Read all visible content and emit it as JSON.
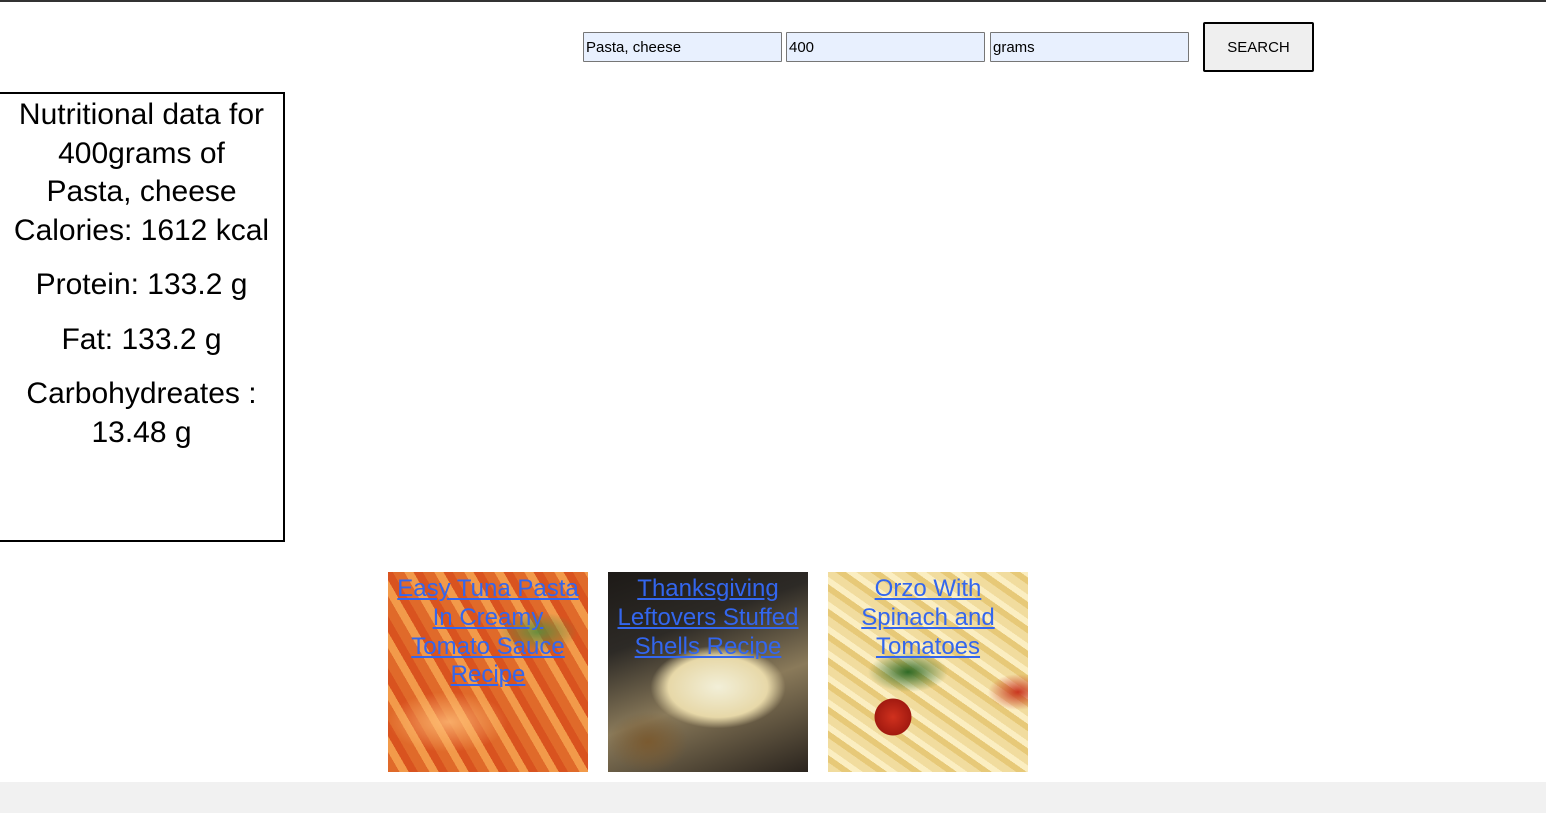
{
  "search": {
    "food_value": "Pasta, cheese",
    "amount_value": "400",
    "unit_value": "grams",
    "button_label": "SEARCH"
  },
  "nutrition": {
    "heading_line1": "Nutritional data for",
    "heading_line2": "400grams of",
    "heading_line3": "Pasta, cheese",
    "calories": "Calories: 1612 kcal",
    "protein": "Protein: 133.2 g",
    "fat": "Fat: 133.2 g",
    "carbs": "Carbohydreates : 13.48 g"
  },
  "recipes": [
    {
      "title": "Easy Tuna Pasta In Creamy Tomato Sauce Recipe"
    },
    {
      "title": "Thanksgiving Leftovers Stuffed Shells Recipe"
    },
    {
      "title": "Orzo With Spinach and Tomatoes"
    }
  ],
  "colors": {
    "link": "#3366ee",
    "input_bg": "#e8f0fe",
    "footer_bg": "#f1f1f1"
  }
}
